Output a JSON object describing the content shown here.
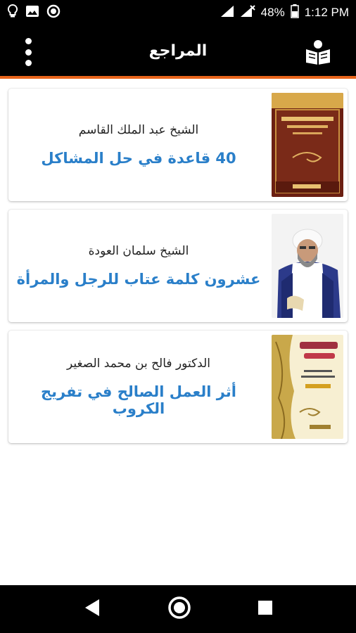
{
  "status_bar": {
    "battery": "48%",
    "time": "1:12 PM"
  },
  "app_bar": {
    "title": "المراجع"
  },
  "references": [
    {
      "author": "الشيخ عبد الملك القاسم",
      "title": "40 قاعدة في حل المشاكل",
      "thumb": "book-cover-brown"
    },
    {
      "author": "الشيخ سلمان العودة",
      "title": "عشرون كلمة عتاب للرجل والمرأة",
      "thumb": "author-portrait"
    },
    {
      "author": "الدكتور فالح بن محمد الصغير",
      "title": "أثر العمل الصالح في تفريج الكروب",
      "thumb": "book-cover-gold"
    }
  ],
  "colors": {
    "accent": "#e8641b",
    "title_blue": "#2a7fc9",
    "bar_bg": "#000000"
  }
}
